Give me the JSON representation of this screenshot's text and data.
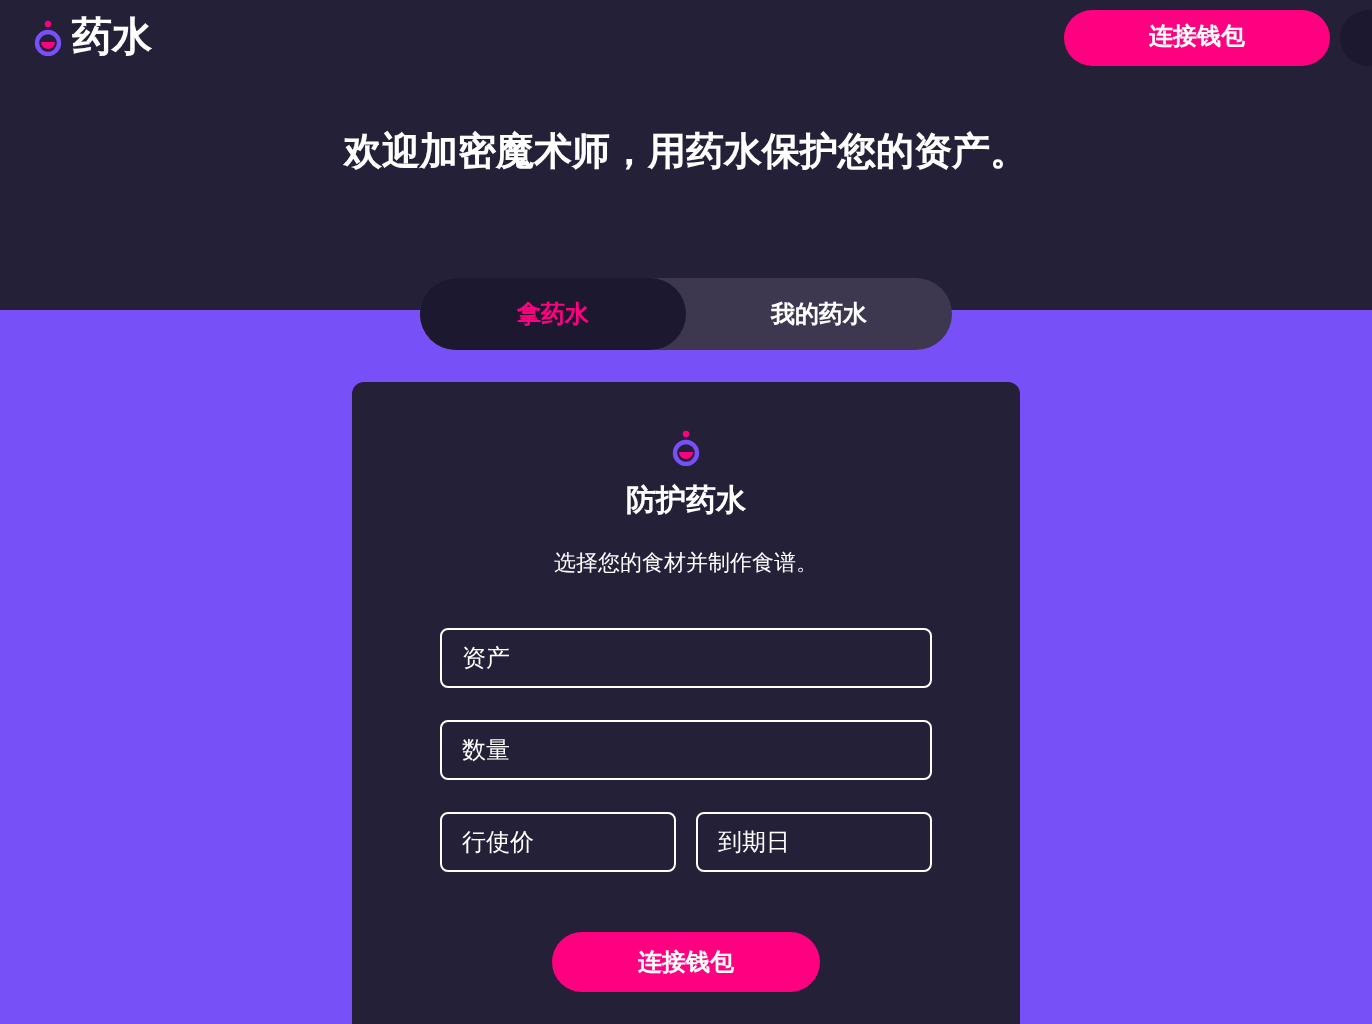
{
  "header": {
    "logo": "药水",
    "connect_button": "连接钱包"
  },
  "headline": "欢迎加密魔术师，用药水保护您的资产。",
  "tabs": [
    {
      "label": "拿药水",
      "selected": true
    },
    {
      "label": "我的药水",
      "selected": false
    }
  ],
  "card": {
    "title": "防护药水",
    "subtitle": "选择您的食材并制作食谱。",
    "fields": [
      {
        "placeholder": "资产",
        "kind": "full"
      },
      {
        "placeholder": "数量",
        "kind": "full"
      },
      {
        "placeholder": "行使价",
        "kind": "half"
      },
      {
        "placeholder": "到期日",
        "kind": "half"
      }
    ],
    "submit_button": "连接钱包"
  }
}
